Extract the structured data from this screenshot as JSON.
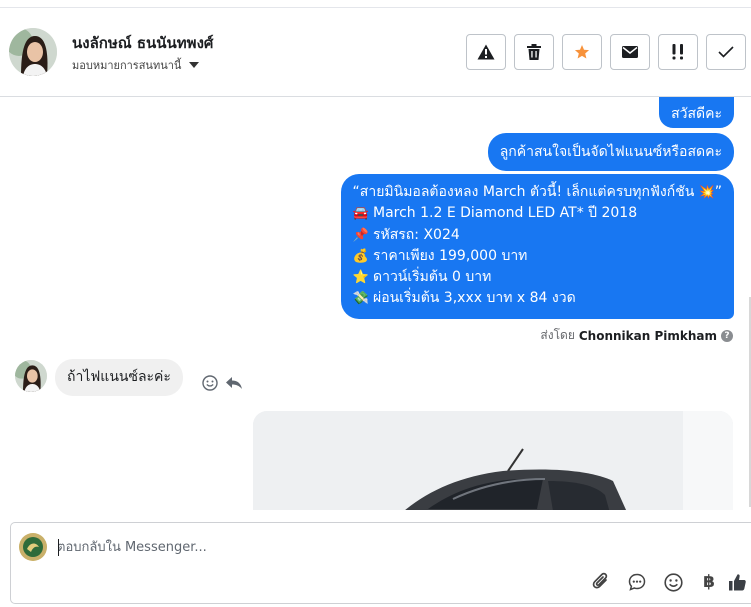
{
  "header": {
    "contact_name": "นงลักษณ์ ธนนันทพงศ์",
    "assign_label": "มอบหมายการสนทนานี้",
    "actions": [
      {
        "name": "report-spam-button",
        "icon": "warning-icon"
      },
      {
        "name": "delete-button",
        "icon": "trash-icon"
      },
      {
        "name": "star-button",
        "icon": "star-icon",
        "color": "#f7923b"
      },
      {
        "name": "mark-unread-button",
        "icon": "envelope-icon"
      },
      {
        "name": "follow-up-button",
        "icon": "double-exclamation-icon"
      },
      {
        "name": "mark-done-button",
        "icon": "checkmark-icon"
      }
    ]
  },
  "messages": {
    "out_1": "สวัสดีคะ",
    "out_2": "ลูกค้าสนใจเป็นจัดไฟแนนซ์หรือสดคะ",
    "promo": {
      "line_1": "“สายมินิมอลต้องหลง March ตัวนี้! เล็กแต่ครบทุกฟังก์ชัน",
      "line_1_end": "”",
      "line_2": "March 1.2 E Diamond LED AT* ปี 2018",
      "line_3": "รหัสรถ: X024",
      "line_4": "ราคาเพียง 199,000 บาท",
      "line_5": "ดาวน์เริ่มต้น 0 บาท",
      "line_6": "ผ่อนเริ่มต้น 3,xxx บาท x 84 งวด",
      "emoji": [
        "💥",
        "🚘",
        "📌",
        "💰",
        "⭐",
        "💸"
      ]
    },
    "sent_by_prefix": "ส่งโดย",
    "sent_by_name": "Chonnikan Pimkham",
    "sent_by_help": "?",
    "in_1": "ถ้าไฟแนนซ์ละค่ะ"
  },
  "composer": {
    "placeholder": "ตอบกลับใน Messenger...",
    "currency_symbol": "฿"
  },
  "colors": {
    "accent": "#1877f2",
    "star": "#f7923b",
    "incoming_bubble": "#f0f0f0"
  }
}
